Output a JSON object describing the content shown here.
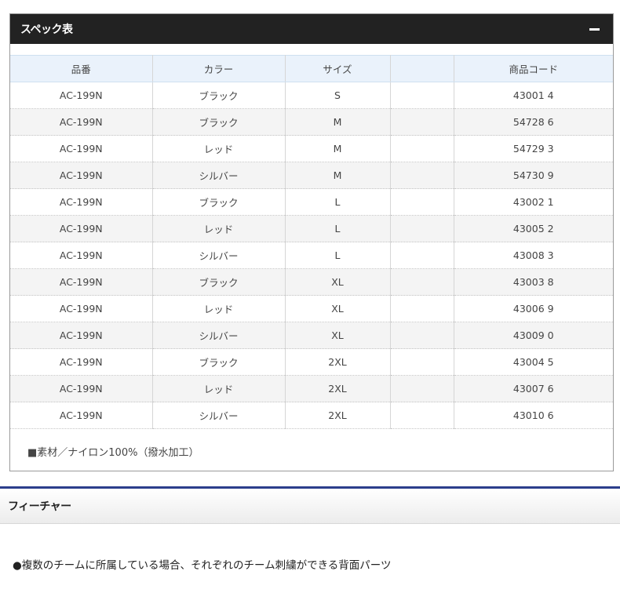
{
  "spec": {
    "title": "スペック表",
    "headers": [
      "品番",
      "カラー",
      "サイズ",
      "",
      "商品コード"
    ],
    "rows": [
      [
        "AC-199N",
        "ブラック",
        "S",
        "",
        "43001 4"
      ],
      [
        "AC-199N",
        "ブラック",
        "M",
        "",
        "54728 6"
      ],
      [
        "AC-199N",
        "レッド",
        "M",
        "",
        "54729 3"
      ],
      [
        "AC-199N",
        "シルバー",
        "M",
        "",
        "54730 9"
      ],
      [
        "AC-199N",
        "ブラック",
        "L",
        "",
        "43002 1"
      ],
      [
        "AC-199N",
        "レッド",
        "L",
        "",
        "43005 2"
      ],
      [
        "AC-199N",
        "シルバー",
        "L",
        "",
        "43008 3"
      ],
      [
        "AC-199N",
        "ブラック",
        "XL",
        "",
        "43003 8"
      ],
      [
        "AC-199N",
        "レッド",
        "XL",
        "",
        "43006 9"
      ],
      [
        "AC-199N",
        "シルバー",
        "XL",
        "",
        "43009 0"
      ],
      [
        "AC-199N",
        "ブラック",
        "2XL",
        "",
        "43004 5"
      ],
      [
        "AC-199N",
        "レッド",
        "2XL",
        "",
        "43007 6"
      ],
      [
        "AC-199N",
        "シルバー",
        "2XL",
        "",
        "43010 6"
      ]
    ],
    "material": "■素材／ナイロン100%（撥水加工）",
    "collapse_icon": "minus-icon"
  },
  "features": {
    "title": "フィーチャー",
    "items": [
      "●複数のチームに所属している場合、それぞれのチーム刺繍ができる背面パーツ"
    ]
  }
}
